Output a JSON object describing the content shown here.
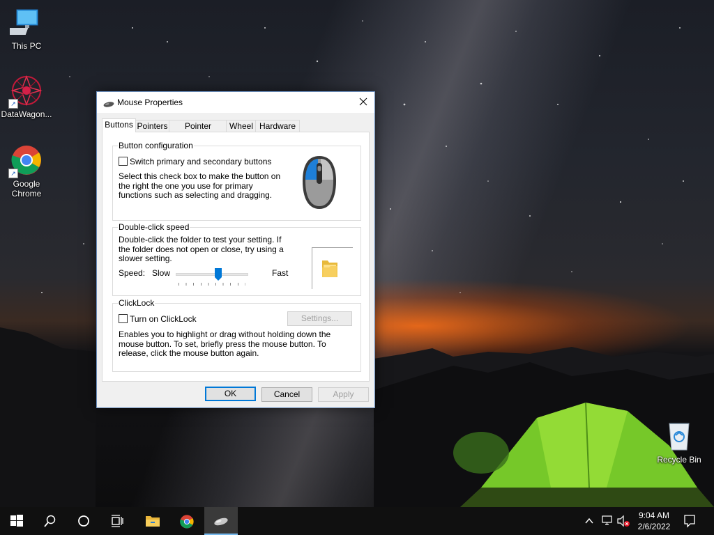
{
  "desktop": {
    "icons": [
      {
        "label": "This PC"
      },
      {
        "label": "DataWagon..."
      },
      {
        "label": "Google Chrome"
      },
      {
        "label": "Recycle Bin"
      }
    ]
  },
  "dialog": {
    "title": "Mouse Properties",
    "tabs": [
      "Buttons",
      "Pointers",
      "Pointer Options",
      "Wheel",
      "Hardware"
    ],
    "active_tab": "Buttons",
    "button_config": {
      "legend": "Button configuration",
      "switch_label": "Switch primary and secondary buttons",
      "switch_checked": false,
      "description": "Select this check box to make the button on the right the one you use for primary functions such as selecting and dragging."
    },
    "double_click": {
      "legend": "Double-click speed",
      "description": "Double-click the folder to test your setting. If the folder does not open or close, try using a slower setting.",
      "speed_label": "Speed:",
      "slow_label": "Slow",
      "fast_label": "Fast",
      "speed_fraction": 0.6
    },
    "clicklock": {
      "legend": "ClickLock",
      "toggle_label": "Turn on ClickLock",
      "toggle_checked": false,
      "settings_label": "Settings...",
      "description": "Enables you to highlight or drag without holding down the mouse button. To set, briefly press the mouse button. To release, click the mouse button again."
    },
    "buttons": {
      "ok": "OK",
      "cancel": "Cancel",
      "apply": "Apply"
    }
  },
  "taskbar": {
    "items": [
      "start-button",
      "search-button",
      "cortana-button",
      "task-view-button",
      "file-explorer",
      "google-chrome",
      "mouse-properties"
    ],
    "time": "9:04 AM",
    "date": "2/6/2022"
  },
  "colors": {
    "accent": "#0078d7",
    "taskbar": "#101010",
    "tent": "#7fd12a"
  }
}
